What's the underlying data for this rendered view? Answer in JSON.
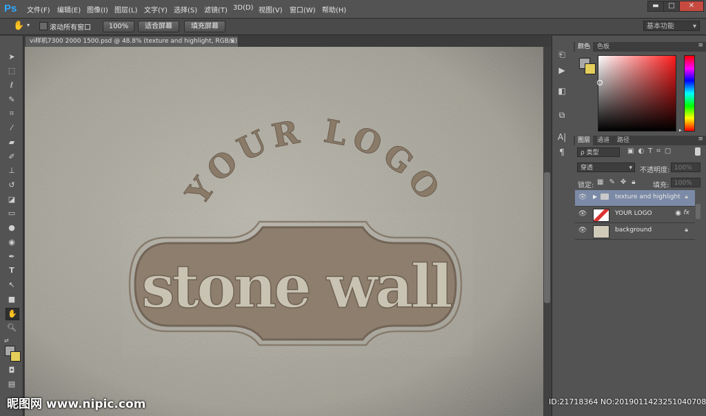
{
  "app": {
    "logo": "Ps"
  },
  "menu": [
    "文件(F)",
    "编辑(E)",
    "图像(I)",
    "图层(L)",
    "文字(Y)",
    "选择(S)",
    "滤镜(T)",
    "3D(D)",
    "视图(V)",
    "窗口(W)",
    "帮助(H)"
  ],
  "window_controls": {
    "minimize": "▬",
    "restore": "□",
    "close": "✕"
  },
  "options_bar": {
    "scroll_all_label": "滚动所有窗口",
    "zoom_100": "100%",
    "fit_screen": "适合屏幕",
    "fill_screen": "填充屏幕",
    "workspace": "基本功能"
  },
  "document": {
    "tab_title": "vi样机7300 2000 1500.psd @ 48.8% (texture and highlight, RGB/8)",
    "close": "×",
    "artwork": {
      "arc_text": "YOUR LOGO",
      "main_text": "stone wall"
    }
  },
  "color_panel": {
    "tabs": [
      "颜色",
      "色板"
    ]
  },
  "layers_panel": {
    "tabs": [
      "图层",
      "通道",
      "路径"
    ],
    "filter_type": "ρ 类型",
    "blend_mode": "穿透",
    "opacity_label": "不透明度:",
    "opacity_value": "100%",
    "lock_label": "锁定:",
    "fill_label": "填充:",
    "fill_value": "100%",
    "layers": [
      {
        "name": "texture and highlight",
        "type": "group",
        "selected": true
      },
      {
        "name": "YOUR LOGO",
        "type": "smart",
        "fx": "fx"
      },
      {
        "name": "background",
        "type": "pixel",
        "locked": true
      }
    ]
  },
  "watermark": {
    "left": "昵图网 www.nipic.com",
    "right": "ID:21718364 NO:20190114232510407084"
  },
  "colors": {
    "accent": "#31a8ff",
    "foreground": "#a8a8a8",
    "background_swatch": "#e5cf5b",
    "selected_layer": "#7b8aa6",
    "stone": "#a29f93",
    "emboss": "#8a7a68"
  }
}
